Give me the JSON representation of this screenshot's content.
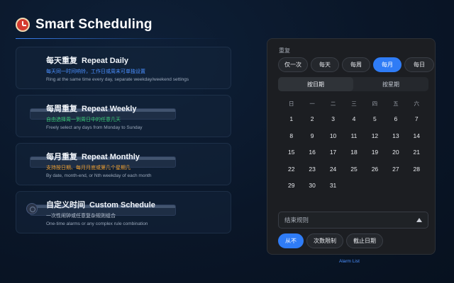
{
  "header": {
    "title": "Smart Scheduling",
    "icon": "alarm-clock-icon"
  },
  "cards": [
    {
      "icon": "calendar-icon",
      "title_cn": "每天重复",
      "title_en": "Repeat Daily",
      "sub": "每天同一时间响铃，工作日或周末可单独设置",
      "sub_color": "#4a8fff",
      "desc": "Ring at the same time every day, separate weekday/weekend settings"
    },
    {
      "icon": "calendar-icon",
      "title_cn": "每周重复",
      "title_en": "Repeat Weekly",
      "sub": "自由选择周一到周日中的任意几天",
      "sub_color": "#3ccf7a",
      "desc": "Freely select any days from Monday to Sunday"
    },
    {
      "icon": "calendar-icon",
      "title_cn": "每月重复",
      "title_en": "Repeat Monthly",
      "sub": "支持按日期、每月月底或第几个星期几",
      "sub_color": "#f0a030",
      "desc": "By date, month-end, or Nth weekday of each month"
    },
    {
      "icon": "gear-icon",
      "title_cn": "自定义时间",
      "title_en": "Custom Schedule",
      "sub": "一次性闹钟或任意复杂规则组合",
      "sub_color": "#b8c2d0",
      "desc": "One-time alarms or any complex rule combination"
    }
  ],
  "panel": {
    "label": "重复",
    "frequency": [
      "仅一次",
      "每天",
      "每周",
      "每月",
      "每日"
    ],
    "frequency_selected": "每月",
    "modes": [
      "按日期",
      "按星期"
    ],
    "mode_selected": "按日期",
    "weekdays": [
      "日",
      "一",
      "二",
      "三",
      "四",
      "五",
      "六"
    ],
    "weeks": [
      [
        "",
        "",
        "",
        "",
        "",
        "",
        ""
      ],
      [
        "1",
        "2",
        "3",
        "4",
        "5",
        "6",
        "7"
      ],
      [
        "8",
        "9",
        "10",
        "11",
        "12",
        "13",
        "14"
      ],
      [
        "15",
        "16",
        "17",
        "18",
        "19",
        "20",
        "21"
      ],
      [
        "22",
        "23",
        "24",
        "25",
        "26",
        "27",
        "28"
      ],
      [
        "29",
        "30",
        "31",
        "",
        "",
        "",
        ""
      ]
    ],
    "end_rule": {
      "label": "结束规则",
      "icon": "caret-up-icon"
    },
    "end_options": [
      "从不",
      "次数限制",
      "截止日期"
    ],
    "end_selected": "从不"
  },
  "footer": {
    "link": "Alarm List"
  },
  "colors": {
    "accent": "#2f7cf6",
    "panel_bg": "#1c1e22",
    "page_bg": "#0a1628"
  }
}
